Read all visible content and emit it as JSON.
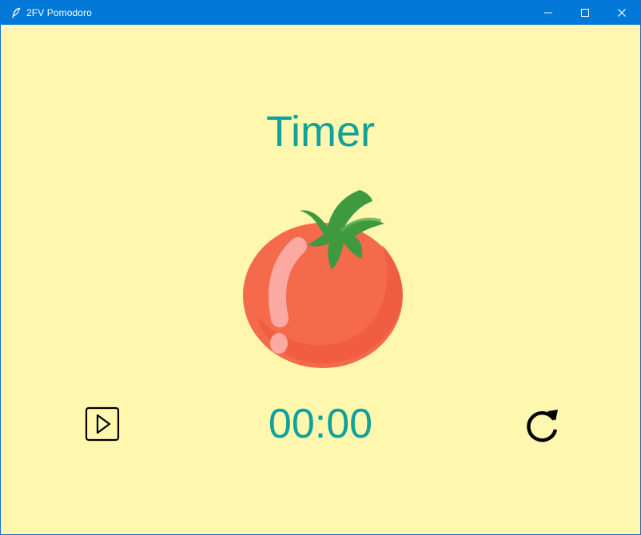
{
  "window": {
    "title": "2FV Pomodoro",
    "controls": [
      "minimize-icon",
      "maximize-icon",
      "close-icon"
    ]
  },
  "app": {
    "heading": "Timer",
    "timer": "00:00",
    "icons": {
      "start": "play-icon",
      "reset": "refresh-icon",
      "illustration": "tomato-icon"
    }
  },
  "colors": {
    "background": "#fff7ae",
    "accent": "#0fa19a",
    "titlebar": "#0078d7",
    "tomato": "#f46a4b",
    "leaf": "#3f9a3f"
  }
}
